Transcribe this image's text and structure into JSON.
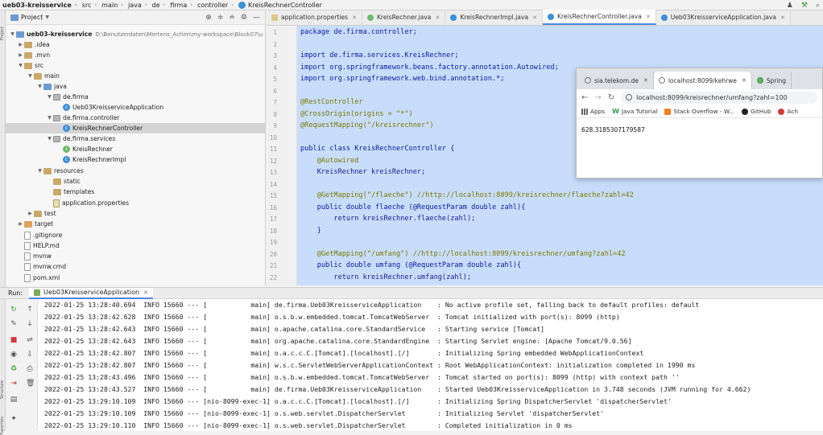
{
  "breadcrumb": {
    "items": [
      "ueb03-kreisservice",
      "src",
      "main",
      "java",
      "de",
      "firma",
      "controller",
      "KreisRechnerController"
    ]
  },
  "project_panel": {
    "title": "Project",
    "root_path": "D:\\Benutzerdaten\\Mertens_Achim\\my-workspace\\Block07\\u",
    "tree": [
      {
        "label": "ueb03-kreisservice",
        "type": "folder-blue"
      },
      {
        "label": ".idea",
        "type": "folder"
      },
      {
        "label": ".mvn",
        "type": "folder"
      },
      {
        "label": "src",
        "type": "folder"
      },
      {
        "label": "main",
        "type": "folder"
      },
      {
        "label": "java",
        "type": "folder-blue"
      },
      {
        "label": "de.firma",
        "type": "package"
      },
      {
        "label": "Ueb03KreisserviceApplication",
        "type": "class"
      },
      {
        "label": "de.firma.controller",
        "type": "package"
      },
      {
        "label": "KreisRechnerController",
        "type": "class"
      },
      {
        "label": "de.firma.services",
        "type": "package"
      },
      {
        "label": "KreisRechner",
        "type": "interface"
      },
      {
        "label": "KreisRechnerImpl",
        "type": "class"
      },
      {
        "label": "resources",
        "type": "folder"
      },
      {
        "label": "static",
        "type": "folder"
      },
      {
        "label": "templates",
        "type": "folder"
      },
      {
        "label": "application.properties",
        "type": "properties"
      },
      {
        "label": "test",
        "type": "folder"
      },
      {
        "label": "target",
        "type": "folder-orange"
      },
      {
        "label": ".gitignore",
        "type": "file"
      },
      {
        "label": "HELP.md",
        "type": "file"
      },
      {
        "label": "mvnw",
        "type": "file"
      },
      {
        "label": "mvnw.cmd",
        "type": "file"
      },
      {
        "label": "pom.xml",
        "type": "file"
      }
    ]
  },
  "editor": {
    "tabs": [
      {
        "label": "application.properties",
        "icon": "properties-icon"
      },
      {
        "label": "KreisRechner.java",
        "icon": "interface-icon"
      },
      {
        "label": "KreisRechnerImpl.java",
        "icon": "class-icon"
      },
      {
        "label": "KreisRechnerController.java",
        "icon": "class-icon"
      },
      {
        "label": "Ueb03KreisserviceApplication.java",
        "icon": "class-icon"
      }
    ],
    "line_numbers": [
      "1",
      "2",
      "3",
      "4",
      "5",
      "6",
      "7",
      "8",
      "9",
      "10",
      "11",
      "12",
      "13",
      "14",
      "15",
      "16",
      "17",
      "18",
      "19",
      "20",
      "21",
      "22"
    ],
    "code": [
      "package de.firma.controller;",
      "",
      "import de.firma.services.KreisRechner;",
      "import org.springframework.beans.factory.annotation.Autowired;",
      "import org.springframework.web.bind.annotation.*;",
      "",
      "@RestController",
      "@CrossOrigin(origins = \"*\")",
      "@RequestMapping(\"/kreisrechner\")",
      "",
      "public class KreisRechnerController {",
      "    @Autowired",
      "    KreisRechner kreisRechner;",
      "",
      "    @GetMapping(\"/flaeche\") //http://localhost:8099/kreisrechner/flaeche?zahl=42",
      "    public double flaeche (@RequestParam double zahl){",
      "        return kreisRechner.flaeche(zahl);",
      "    }",
      "",
      "    @GetMapping(\"/umfang\") //http://localhost:8099/kreisrechner/umfang?zahl=42",
      "    public double umfang (@RequestParam double zahl){",
      "        return kreisRechner.umfang(zahl);"
    ]
  },
  "browser": {
    "tabs": [
      {
        "label": "sia.telekom.de"
      },
      {
        "label": "localhost:8099/kehrwe"
      },
      {
        "label": "Spring"
      }
    ],
    "address": "localhost:8099/kreisrechner/umfang?zahl=100",
    "bookmarks": [
      "Apps",
      "Java Tutorial",
      "Stack Overflow - W...",
      "GitHub",
      "Ach"
    ],
    "content": "628.3185307179587"
  },
  "run": {
    "label": "Run:",
    "tab_label": "Ueb03KreisserviceApplication",
    "log_lines": [
      "2022-01-25 13:28:40.694  INFO 15660 --- [           main] de.firma.Ueb03KreisserviceApplication    : No active profile set, falling back to default profiles: default",
      "2022-01-25 13:28:42.628  INFO 15660 --- [           main] o.s.b.w.embedded.tomcat.TomcatWebServer  : Tomcat initialized with port(s): 8099 (http)",
      "2022-01-25 13:28:42.643  INFO 15660 --- [           main] o.apache.catalina.core.StandardService   : Starting service [Tomcat]",
      "2022-01-25 13:28:42.643  INFO 15660 --- [           main] org.apache.catalina.core.StandardEngine  : Starting Servlet engine: [Apache Tomcat/9.0.56]",
      "2022-01-25 13:28:42.807  INFO 15660 --- [           main] o.a.c.c.C.[Tomcat].[localhost].[/]       : Initializing Spring embedded WebApplicationContext",
      "2022-01-25 13:28:42.807  INFO 15660 --- [           main] w.s.c.ServletWebServerApplicationContext : Root WebApplicationContext: initialization completed in 1990 ms",
      "2022-01-25 13:28:43.496  INFO 15660 --- [           main] o.s.b.w.embedded.tomcat.TomcatWebServer  : Tomcat started on port(s): 8099 (http) with context path ''",
      "2022-01-25 13:28:43.527  INFO 15660 --- [           main] de.firma.Ueb03KreisserviceApplication    : Started Ueb03KreisserviceApplication in 3.748 seconds (JVM running for 4.662)",
      "2022-01-25 13:29:10.109  INFO 15660 --- [nio-8099-exec-1] o.a.c.c.C.[Tomcat].[localhost].[/]       : Initializing Spring DispatcherServlet 'dispatcherServlet'",
      "2022-01-25 13:29:10.109  INFO 15660 --- [nio-8099-exec-1] o.s.web.servlet.DispatcherServlet        : Initializing Servlet 'dispatcherServlet'",
      "2022-01-25 13:29:10.110  INFO 15660 --- [nio-8099-exec-1] o.s.web.servlet.DispatcherServlet        : Completed initialization in 0 ms"
    ]
  },
  "side_labels": {
    "left_top": "Project",
    "left_middle": "Structure",
    "left_bottom": "Favorites"
  },
  "colors": {
    "selection": "#c8ddfb",
    "accent": "#4a86e8"
  }
}
